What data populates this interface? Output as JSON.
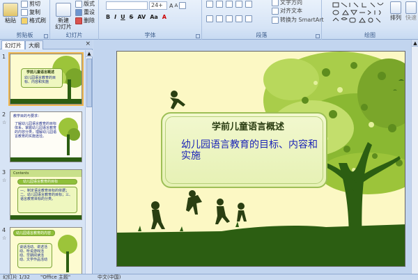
{
  "ribbon": {
    "clipboard": {
      "label": "剪贴板",
      "paste": "粘贴",
      "cut": "剪切",
      "copy": "复制",
      "format_painter": "格式刷"
    },
    "slides": {
      "label": "幻灯片",
      "new_slide": "新建\n幻灯片",
      "layout": "版式",
      "reset": "重设",
      "delete": "删除"
    },
    "font": {
      "label": "字体",
      "size": "24+"
    },
    "paragraph": {
      "label": "段落",
      "text_direction": "文字方向",
      "align_text": "对齐文本",
      "smartart": "转换为 SmartArt"
    },
    "drawing": {
      "label": "绘图",
      "arrange": "排列",
      "quick_styles": "快速"
    }
  },
  "panel": {
    "tab_slides": "幻灯片",
    "tab_outline": "大纲",
    "close": "×",
    "slides": [
      {
        "num": "1",
        "title": "学前儿童语言概述",
        "subtitle": "幼儿园语言教育的目标、内容和实施"
      },
      {
        "num": "2",
        "heading": "教学目的与要求：",
        "body": "了解幼儿园语言教育的目标体系，掌握幼儿园语言教育的内容分类，理解幼儿园语言教育的实施途径。"
      },
      {
        "num": "3",
        "heading": "Contents",
        "item": "幼儿园语言教育的目标",
        "body": "—、制定语言教育目标的依据；二、幼儿园语言教育的目标；三、语言教育目标的分类。"
      },
      {
        "num": "4",
        "heading": "幼儿园语言教育的内容",
        "body": "谈话活动、讲述活动、听说游戏活动、早期阅读活动、文学作品活动"
      }
    ]
  },
  "slide": {
    "title": "学前儿童语言概述",
    "subtitle": "幼儿园语言教育的目标、内容和实施"
  },
  "status": {
    "slide_info": "幻灯片 1/32",
    "theme": "\"Office 主题\"",
    "language": "中文(中国)"
  },
  "colors": {
    "accent_green": "#9dbf56",
    "title_blue": "#1a23b8",
    "ribbon_bg": "#d6e4f6"
  }
}
